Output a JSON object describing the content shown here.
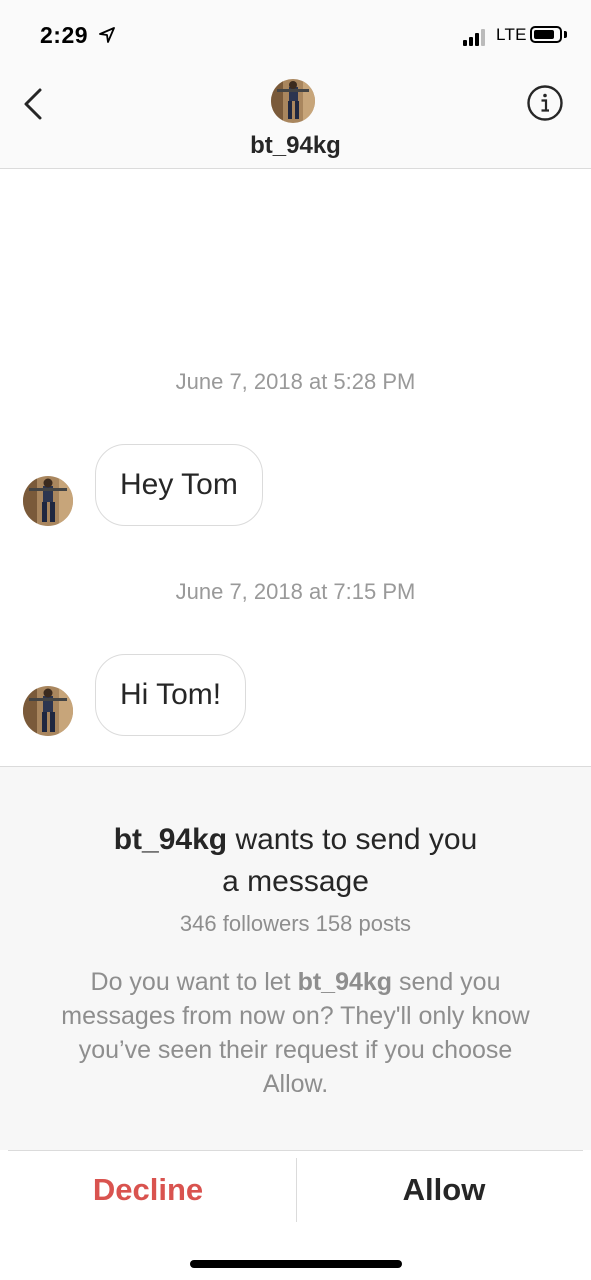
{
  "status_bar": {
    "time": "2:29",
    "network": "LTE"
  },
  "header": {
    "username": "bt_94kg",
    "back_icon": "chevron-left-icon",
    "info_icon": "info-circle-icon"
  },
  "conversation": [
    {
      "timestamp": "June 7, 2018 at 5:28 PM",
      "message": "Hey Tom"
    },
    {
      "timestamp": "June 7, 2018 at 7:15 PM",
      "message": "Hi Tom!"
    }
  ],
  "request": {
    "username": "bt_94kg",
    "title_suffix": " wants to send you",
    "title_line2": "a message",
    "stats": "346 followers 158 posts",
    "body_prefix": "Do you want to let ",
    "body_username": "bt_94kg",
    "body_suffix": " send you messages from now on? They'll only know you’ve seen their request if you choose Allow."
  },
  "actions": {
    "decline_label": "Decline",
    "allow_label": "Allow",
    "decline_color": "#d9534f"
  }
}
